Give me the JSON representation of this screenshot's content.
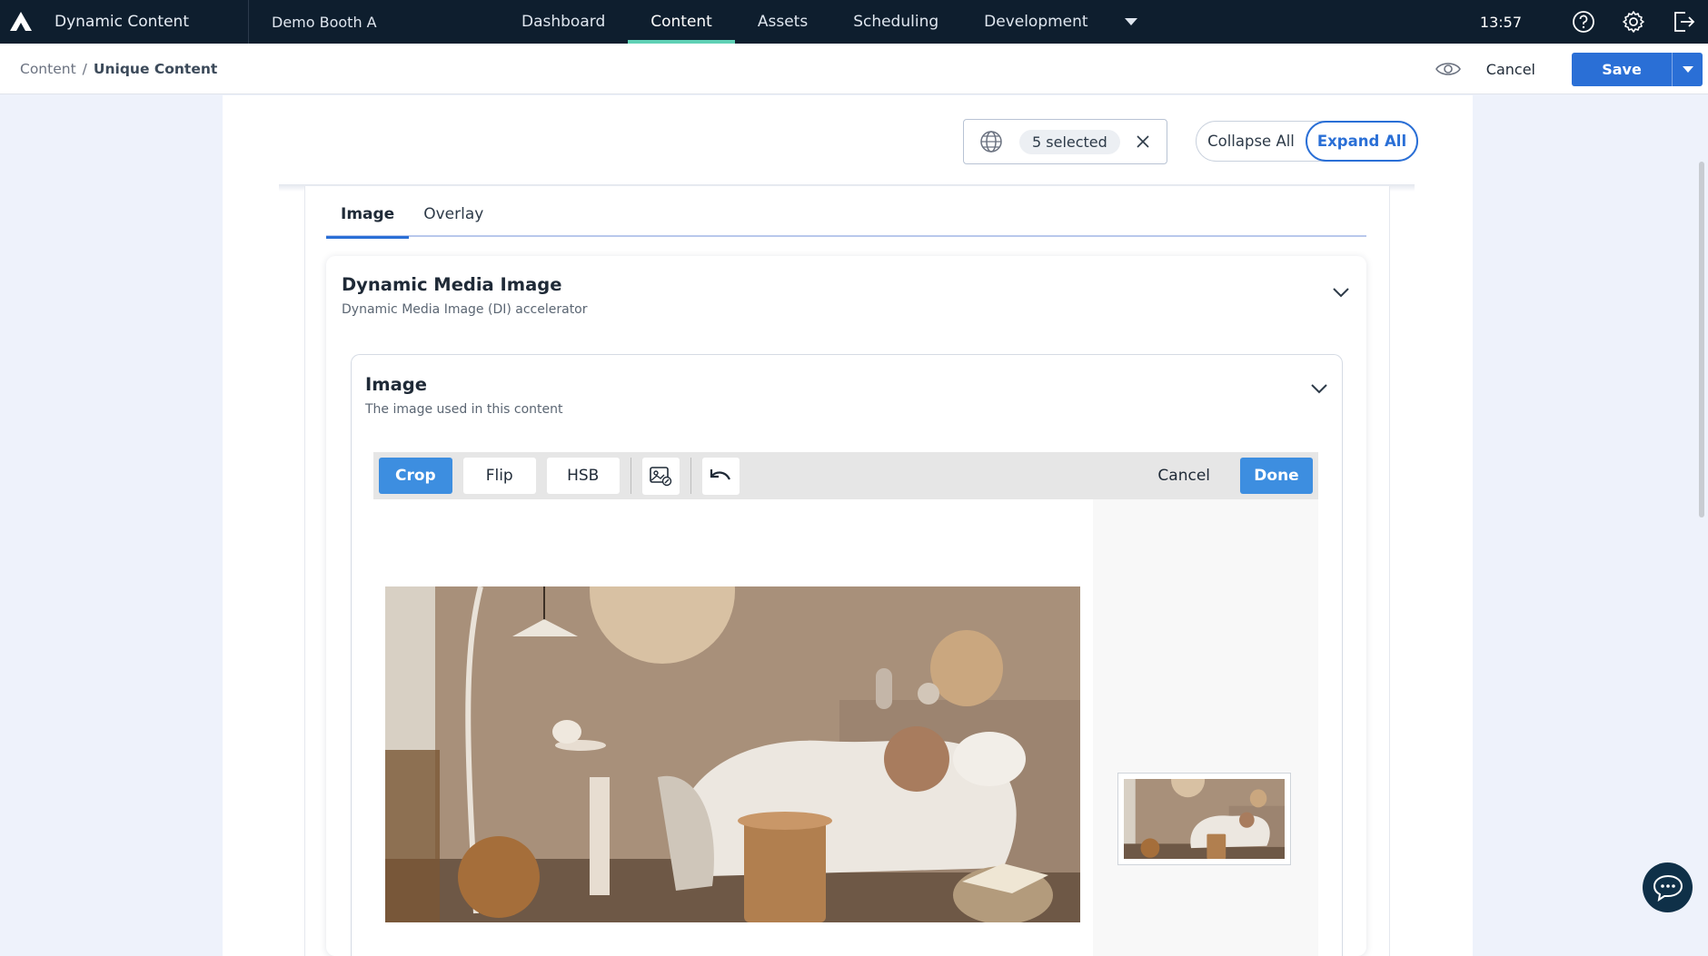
{
  "topbar": {
    "app_name": "Dynamic Content",
    "hub_name": "Demo Booth A",
    "nav": [
      "Dashboard",
      "Content",
      "Assets",
      "Scheduling",
      "Development"
    ],
    "active_nav": "Content",
    "time": "13:57",
    "icons": [
      "help-icon",
      "gear-icon",
      "logout-icon"
    ]
  },
  "subbar": {
    "breadcrumb_root": "Content",
    "breadcrumb_sep": "/",
    "breadcrumb_current": "Unique Content",
    "cancel_label": "Cancel",
    "save_label": "Save"
  },
  "filters": {
    "locale_selection": "5 selected",
    "collapse_all": "Collapse All",
    "expand_all": "Expand All",
    "active_toggle": "Expand All"
  },
  "tabs": [
    "Image",
    "Overlay"
  ],
  "active_tab": "Image",
  "card": {
    "title": "Dynamic Media Image",
    "subtitle": "Dynamic Media Image (DI) accelerator"
  },
  "image_field": {
    "title": "Image",
    "subtitle": "The image used in this content"
  },
  "editor_toolbar": {
    "crop": "Crop",
    "flip": "Flip",
    "hsb": "HSB",
    "cancel": "Cancel",
    "done": "Done",
    "active_tool": "Crop"
  },
  "colors": {
    "topbar_bg": "#0e1e2e",
    "nav_active_underline": "#5fd0b5",
    "primary": "#2a6fd6",
    "toolbar_primary": "#3d8ee0"
  }
}
